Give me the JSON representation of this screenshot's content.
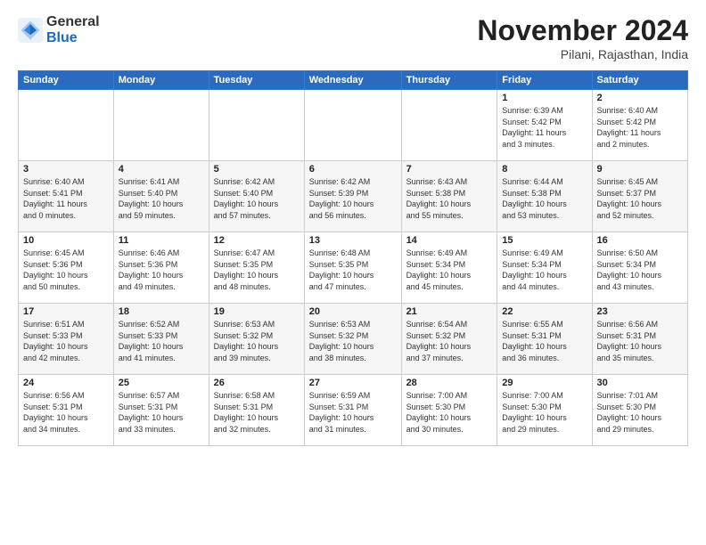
{
  "header": {
    "logo_general": "General",
    "logo_blue": "Blue",
    "month_title": "November 2024",
    "location": "Pilani, Rajasthan, India"
  },
  "days_of_week": [
    "Sunday",
    "Monday",
    "Tuesday",
    "Wednesday",
    "Thursday",
    "Friday",
    "Saturday"
  ],
  "weeks": [
    [
      {
        "day": "",
        "info": ""
      },
      {
        "day": "",
        "info": ""
      },
      {
        "day": "",
        "info": ""
      },
      {
        "day": "",
        "info": ""
      },
      {
        "day": "",
        "info": ""
      },
      {
        "day": "1",
        "info": "Sunrise: 6:39 AM\nSunset: 5:42 PM\nDaylight: 11 hours\nand 3 minutes."
      },
      {
        "day": "2",
        "info": "Sunrise: 6:40 AM\nSunset: 5:42 PM\nDaylight: 11 hours\nand 2 minutes."
      }
    ],
    [
      {
        "day": "3",
        "info": "Sunrise: 6:40 AM\nSunset: 5:41 PM\nDaylight: 11 hours\nand 0 minutes."
      },
      {
        "day": "4",
        "info": "Sunrise: 6:41 AM\nSunset: 5:40 PM\nDaylight: 10 hours\nand 59 minutes."
      },
      {
        "day": "5",
        "info": "Sunrise: 6:42 AM\nSunset: 5:40 PM\nDaylight: 10 hours\nand 57 minutes."
      },
      {
        "day": "6",
        "info": "Sunrise: 6:42 AM\nSunset: 5:39 PM\nDaylight: 10 hours\nand 56 minutes."
      },
      {
        "day": "7",
        "info": "Sunrise: 6:43 AM\nSunset: 5:38 PM\nDaylight: 10 hours\nand 55 minutes."
      },
      {
        "day": "8",
        "info": "Sunrise: 6:44 AM\nSunset: 5:38 PM\nDaylight: 10 hours\nand 53 minutes."
      },
      {
        "day": "9",
        "info": "Sunrise: 6:45 AM\nSunset: 5:37 PM\nDaylight: 10 hours\nand 52 minutes."
      }
    ],
    [
      {
        "day": "10",
        "info": "Sunrise: 6:45 AM\nSunset: 5:36 PM\nDaylight: 10 hours\nand 50 minutes."
      },
      {
        "day": "11",
        "info": "Sunrise: 6:46 AM\nSunset: 5:36 PM\nDaylight: 10 hours\nand 49 minutes."
      },
      {
        "day": "12",
        "info": "Sunrise: 6:47 AM\nSunset: 5:35 PM\nDaylight: 10 hours\nand 48 minutes."
      },
      {
        "day": "13",
        "info": "Sunrise: 6:48 AM\nSunset: 5:35 PM\nDaylight: 10 hours\nand 47 minutes."
      },
      {
        "day": "14",
        "info": "Sunrise: 6:49 AM\nSunset: 5:34 PM\nDaylight: 10 hours\nand 45 minutes."
      },
      {
        "day": "15",
        "info": "Sunrise: 6:49 AM\nSunset: 5:34 PM\nDaylight: 10 hours\nand 44 minutes."
      },
      {
        "day": "16",
        "info": "Sunrise: 6:50 AM\nSunset: 5:34 PM\nDaylight: 10 hours\nand 43 minutes."
      }
    ],
    [
      {
        "day": "17",
        "info": "Sunrise: 6:51 AM\nSunset: 5:33 PM\nDaylight: 10 hours\nand 42 minutes."
      },
      {
        "day": "18",
        "info": "Sunrise: 6:52 AM\nSunset: 5:33 PM\nDaylight: 10 hours\nand 41 minutes."
      },
      {
        "day": "19",
        "info": "Sunrise: 6:53 AM\nSunset: 5:32 PM\nDaylight: 10 hours\nand 39 minutes."
      },
      {
        "day": "20",
        "info": "Sunrise: 6:53 AM\nSunset: 5:32 PM\nDaylight: 10 hours\nand 38 minutes."
      },
      {
        "day": "21",
        "info": "Sunrise: 6:54 AM\nSunset: 5:32 PM\nDaylight: 10 hours\nand 37 minutes."
      },
      {
        "day": "22",
        "info": "Sunrise: 6:55 AM\nSunset: 5:31 PM\nDaylight: 10 hours\nand 36 minutes."
      },
      {
        "day": "23",
        "info": "Sunrise: 6:56 AM\nSunset: 5:31 PM\nDaylight: 10 hours\nand 35 minutes."
      }
    ],
    [
      {
        "day": "24",
        "info": "Sunrise: 6:56 AM\nSunset: 5:31 PM\nDaylight: 10 hours\nand 34 minutes."
      },
      {
        "day": "25",
        "info": "Sunrise: 6:57 AM\nSunset: 5:31 PM\nDaylight: 10 hours\nand 33 minutes."
      },
      {
        "day": "26",
        "info": "Sunrise: 6:58 AM\nSunset: 5:31 PM\nDaylight: 10 hours\nand 32 minutes."
      },
      {
        "day": "27",
        "info": "Sunrise: 6:59 AM\nSunset: 5:31 PM\nDaylight: 10 hours\nand 31 minutes."
      },
      {
        "day": "28",
        "info": "Sunrise: 7:00 AM\nSunset: 5:30 PM\nDaylight: 10 hours\nand 30 minutes."
      },
      {
        "day": "29",
        "info": "Sunrise: 7:00 AM\nSunset: 5:30 PM\nDaylight: 10 hours\nand 29 minutes."
      },
      {
        "day": "30",
        "info": "Sunrise: 7:01 AM\nSunset: 5:30 PM\nDaylight: 10 hours\nand 29 minutes."
      }
    ]
  ]
}
